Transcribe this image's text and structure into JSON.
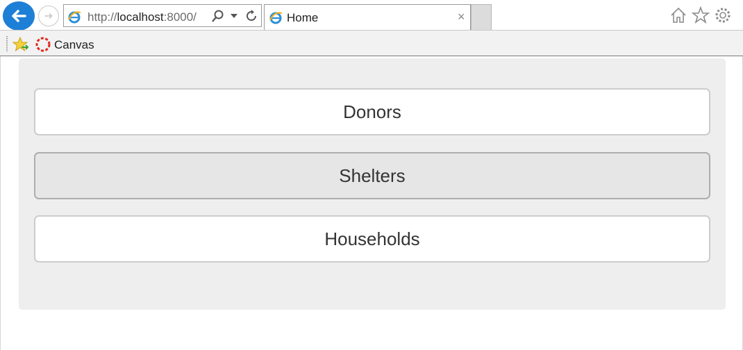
{
  "browser": {
    "url_prefix": "http://",
    "url_host": "localhost",
    "url_rest": ":8000/",
    "tab_title": "Home",
    "tab_close": "×",
    "favorites": [
      {
        "label": "Canvas",
        "icon": "canvas-icon"
      }
    ]
  },
  "main": {
    "buttons": [
      {
        "label": "Donors",
        "state": "default"
      },
      {
        "label": "Shelters",
        "state": "active"
      },
      {
        "label": "Households",
        "state": "default"
      }
    ]
  },
  "colors": {
    "accent": "#1e7fd6",
    "panel": "#eeeeee",
    "active_button": "#e6e6e6"
  }
}
